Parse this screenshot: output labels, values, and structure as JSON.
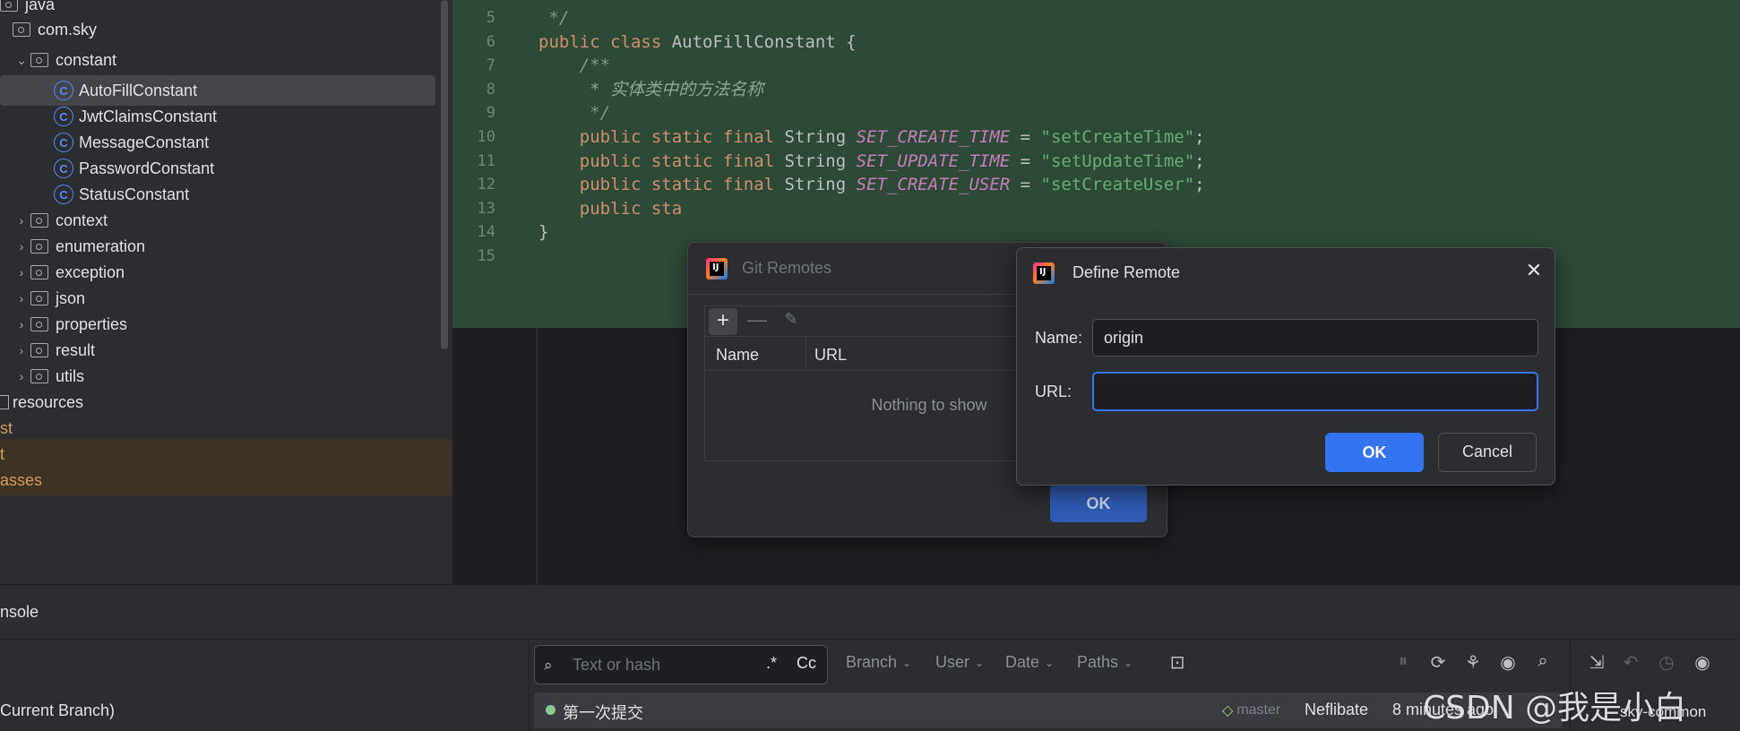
{
  "project_tree": {
    "items": [
      {
        "label": "java",
        "indent": 0,
        "kind": "folder",
        "chevron": ""
      },
      {
        "label": "com.sky",
        "indent": 0,
        "kind": "folder",
        "chevron": ""
      },
      {
        "label": "constant",
        "indent": 1,
        "kind": "folder",
        "chevron": "⌄"
      },
      {
        "label": "AutoFillConstant",
        "indent": 2,
        "kind": "class",
        "chevron": "",
        "selected": true
      },
      {
        "label": "JwtClaimsConstant",
        "indent": 2,
        "kind": "class",
        "chevron": ""
      },
      {
        "label": "MessageConstant",
        "indent": 2,
        "kind": "class",
        "chevron": ""
      },
      {
        "label": "PasswordConstant",
        "indent": 2,
        "kind": "class",
        "chevron": ""
      },
      {
        "label": "StatusConstant",
        "indent": 2,
        "kind": "class",
        "chevron": ""
      },
      {
        "label": "context",
        "indent": 1,
        "kind": "folder",
        "chevron": "›"
      },
      {
        "label": "enumeration",
        "indent": 1,
        "kind": "folder",
        "chevron": "›"
      },
      {
        "label": "exception",
        "indent": 1,
        "kind": "folder",
        "chevron": "›"
      },
      {
        "label": "json",
        "indent": 1,
        "kind": "folder",
        "chevron": "›"
      },
      {
        "label": "properties",
        "indent": 1,
        "kind": "folder",
        "chevron": "›"
      },
      {
        "label": "result",
        "indent": 1,
        "kind": "folder",
        "chevron": "›"
      },
      {
        "label": "utils",
        "indent": 1,
        "kind": "folder",
        "chevron": "›"
      },
      {
        "label": "resources",
        "indent": 0,
        "kind": "resources",
        "chevron": ""
      },
      {
        "label": "st",
        "indent": 0,
        "kind": "plain-orange",
        "chevron": ""
      },
      {
        "label": "t",
        "indent": 0,
        "kind": "excluded",
        "chevron": ""
      },
      {
        "label": "asses",
        "indent": 0,
        "kind": "excluded",
        "chevron": ""
      }
    ]
  },
  "editor": {
    "lines": [
      {
        "n": "5",
        "parts": [
          {
            "t": " */",
            "c": "cm"
          }
        ]
      },
      {
        "n": "6",
        "parts": [
          {
            "t": "public class ",
            "c": "kw"
          },
          {
            "t": "AutoFillConstant {",
            "c": "pl"
          }
        ]
      },
      {
        "n": "7",
        "parts": [
          {
            "t": "    /**",
            "c": "cm"
          }
        ]
      },
      {
        "n": "8",
        "parts": [
          {
            "t": "     * 实体类中的方法名称",
            "c": "cmd"
          }
        ]
      },
      {
        "n": "9",
        "parts": [
          {
            "t": "     */",
            "c": "cm"
          }
        ]
      },
      {
        "n": "10",
        "parts": [
          {
            "t": "    public static final ",
            "c": "kw"
          },
          {
            "t": "String ",
            "c": "pl"
          },
          {
            "t": "SET_CREATE_TIME",
            "c": "fld"
          },
          {
            "t": " = ",
            "c": "pl"
          },
          {
            "t": "\"setCreateTime\"",
            "c": "str"
          },
          {
            "t": ";",
            "c": "pl"
          }
        ]
      },
      {
        "n": "11",
        "parts": [
          {
            "t": "    public static final ",
            "c": "kw"
          },
          {
            "t": "String ",
            "c": "pl"
          },
          {
            "t": "SET_UPDATE_TIME",
            "c": "fld"
          },
          {
            "t": " = ",
            "c": "pl"
          },
          {
            "t": "\"setUpdateTime\"",
            "c": "str"
          },
          {
            "t": ";",
            "c": "pl"
          }
        ]
      },
      {
        "n": "12",
        "parts": [
          {
            "t": "    public static final ",
            "c": "kw"
          },
          {
            "t": "String ",
            "c": "pl"
          },
          {
            "t": "SET_CREATE_USER",
            "c": "fld"
          },
          {
            "t": " = ",
            "c": "pl"
          },
          {
            "t": "\"setCreateUser\"",
            "c": "str"
          },
          {
            "t": ";",
            "c": "pl"
          }
        ]
      },
      {
        "n": "13",
        "parts": [
          {
            "t": "    public sta",
            "c": "kw"
          }
        ]
      },
      {
        "n": "14",
        "parts": [
          {
            "t": "}",
            "c": "pl"
          }
        ]
      },
      {
        "n": "15",
        "parts": []
      }
    ]
  },
  "git_remotes_dialog": {
    "title": "Git Remotes",
    "add_icon": "+",
    "remove_icon": "—",
    "edit_icon": "✎",
    "columns": [
      "Name",
      "URL"
    ],
    "empty_text": "Nothing to show",
    "ok_label": "OK"
  },
  "define_remote_dialog": {
    "title": "Define Remote",
    "close_icon": "✕",
    "name_label": "Name:",
    "name_value": "origin",
    "url_label": "URL:",
    "url_value": "",
    "ok_label": "OK",
    "cancel_label": "Cancel"
  },
  "git_log": {
    "console_tab": "nsole",
    "branch_filter_label": "Current Branch)",
    "search_placeholder": "Text or hash",
    "regex_label": ".*",
    "case_label": "Cc",
    "filters": [
      "Branch",
      "User",
      "Date",
      "Paths"
    ],
    "commit": {
      "message": "第一次提交",
      "branch_tag": "master",
      "author": "Neflibate",
      "time": "8 minutes ago"
    },
    "module_label": "sky-common"
  },
  "watermark": "CSDN @我是小白mis",
  "colors": {
    "accent": "#3574f0",
    "editor_highlight": "#2d4a36",
    "keyword": "#cf8e6d",
    "string": "#6aab73",
    "field": "#c77dbb"
  }
}
